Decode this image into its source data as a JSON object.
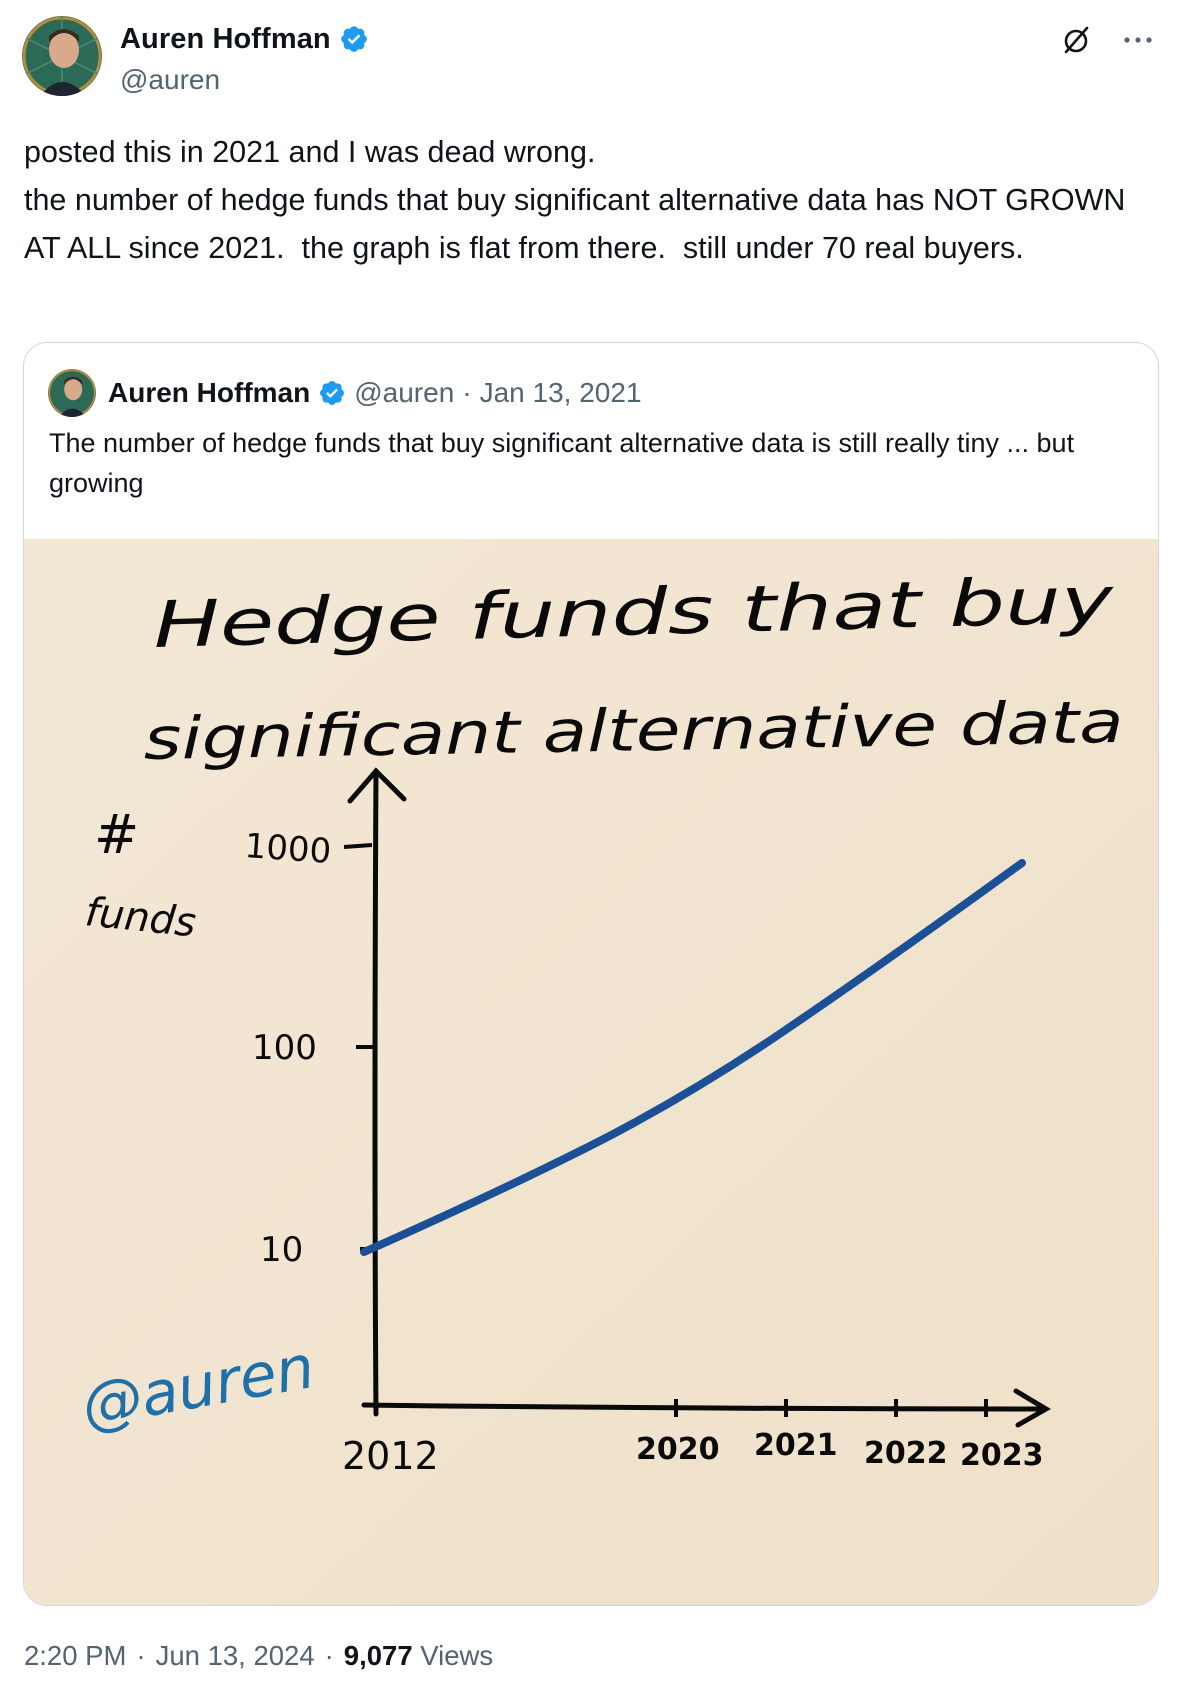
{
  "tweet": {
    "author_name": "Auren Hoffman",
    "author_handle": "@auren",
    "text": "posted this in 2021 and I was dead wrong.\nthe number of hedge funds that buy significant alternative data has NOT GROWN AT ALL since 2021.  the graph is flat from there.  still under 70 real buyers.",
    "time": "2:20 PM",
    "date": "Jun 13, 2024",
    "views_count": "9,077",
    "views_label": "Views",
    "separator": "·"
  },
  "quoted": {
    "author_name": "Auren Hoffman",
    "author_handle": "@auren",
    "separator": "·",
    "date": "Jan 13, 2021",
    "text": "The number of hedge funds that buy significant alternative data is still really tiny ... but growing"
  },
  "drawing": {
    "title_line1": "Hedge funds that buy",
    "title_line2": "significant alternative data",
    "y_label_symbol": "#",
    "y_label_word": "funds",
    "y_ticks": [
      "1000",
      "100",
      "10"
    ],
    "x_ticks": [
      "2012",
      "2020",
      "2021",
      "2022",
      "2023"
    ],
    "watermark": "@auren"
  },
  "colors": {
    "brand_blue": "#1d9bf0",
    "text": "#0f1419",
    "secondary": "#536471",
    "border": "#cfd9de",
    "paper": "#f4e9d9",
    "ink": "#0a0a0a",
    "line_blue": "#1b4f96"
  },
  "icons": [
    "grok-icon",
    "more-icon",
    "verified-badge-icon"
  ]
}
